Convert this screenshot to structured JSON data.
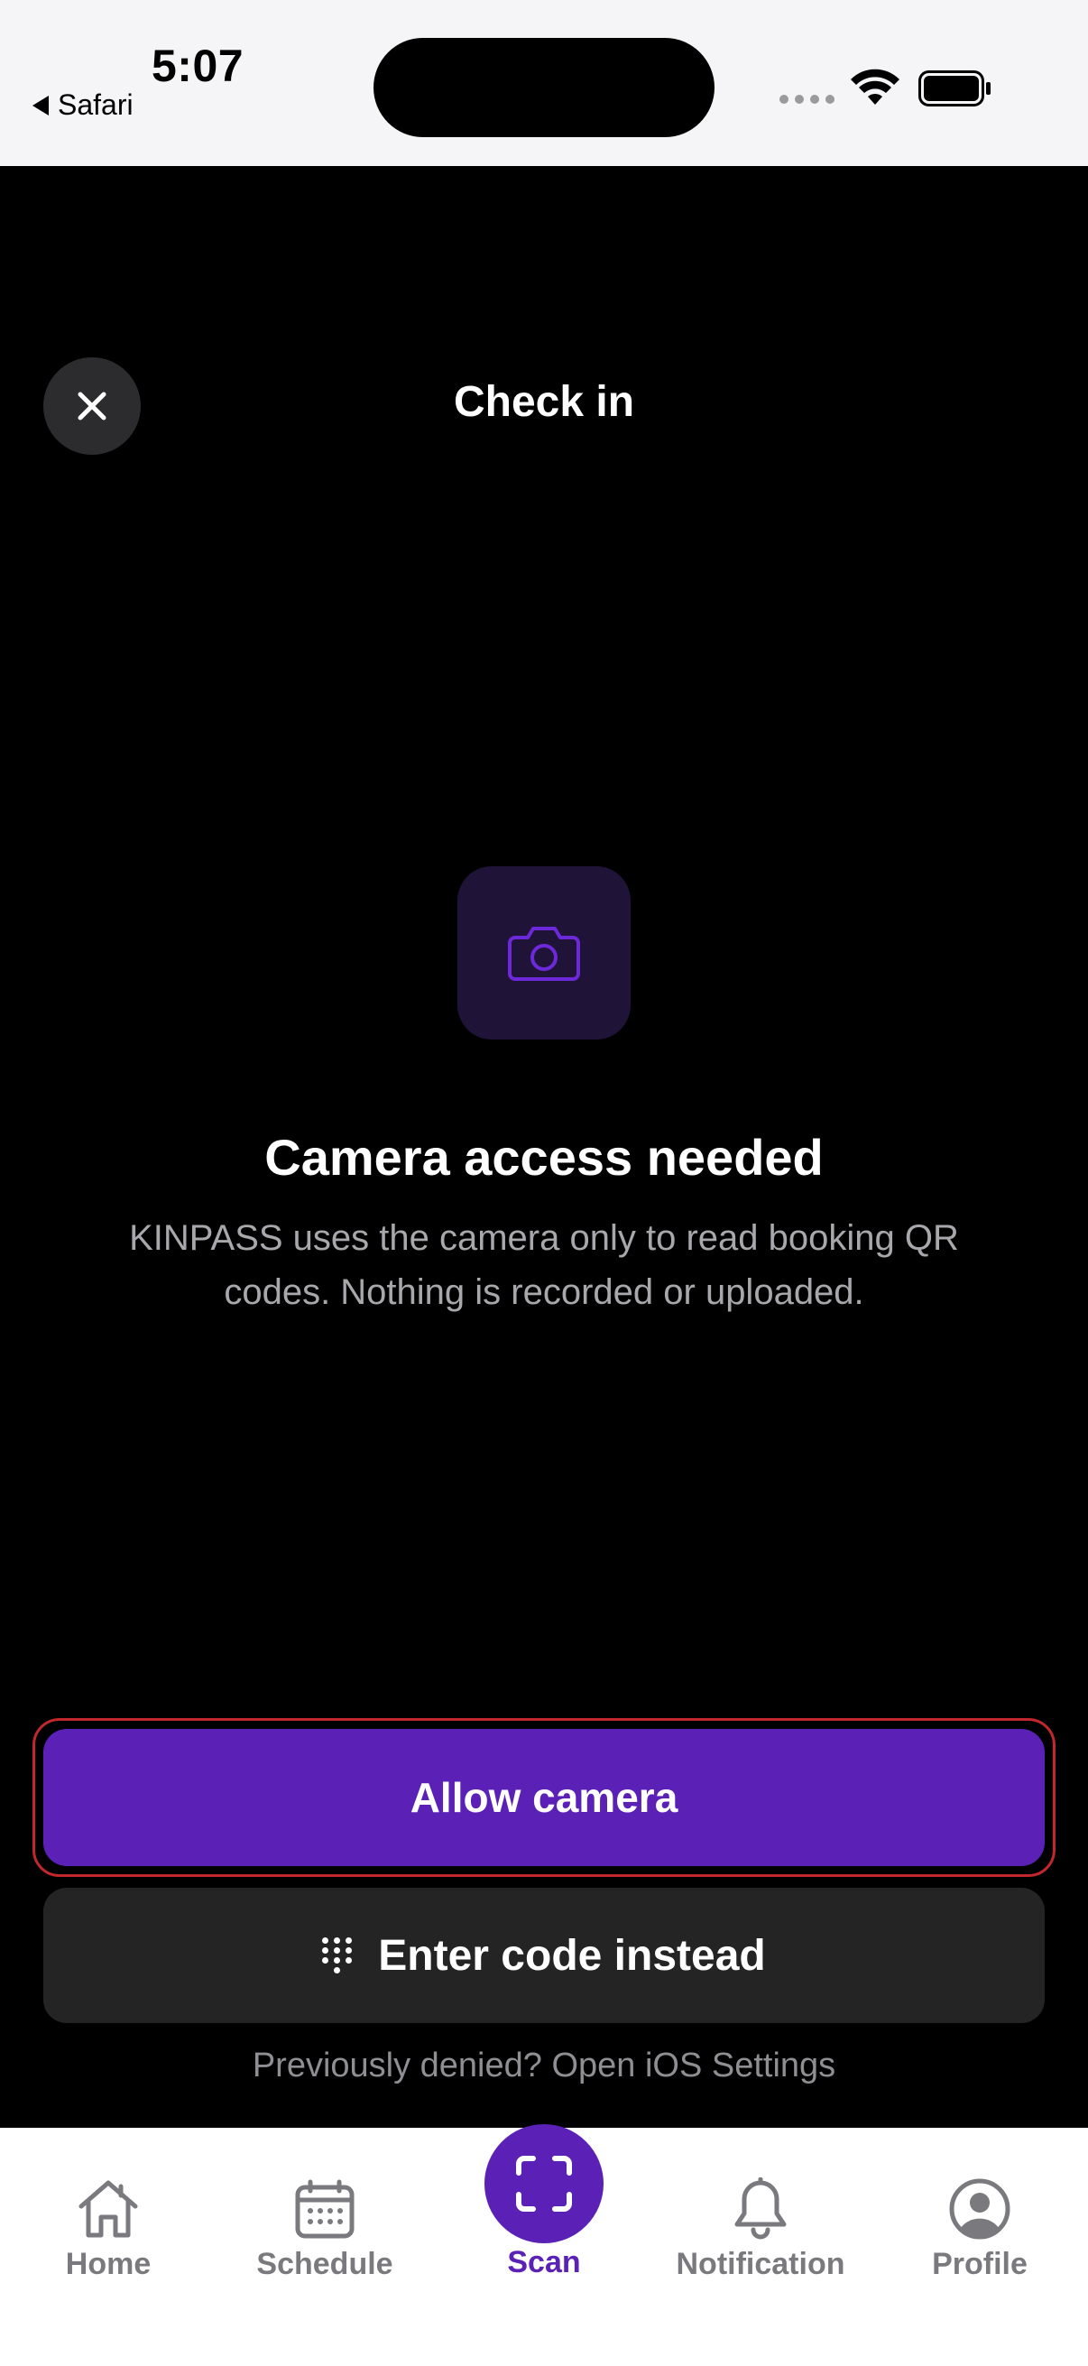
{
  "status_bar": {
    "time": "5:07",
    "back_app": "Safari",
    "icons": [
      "cellular-signal-icon",
      "wifi-icon",
      "battery-icon"
    ]
  },
  "header": {
    "title": "Check in",
    "close_icon": "close-icon"
  },
  "permission": {
    "icon": "camera-icon",
    "headline": "Camera access needed",
    "description": "KINPASS uses the camera only to read booking QR codes. Nothing is recorded or uploaded."
  },
  "actions": {
    "allow_label": "Allow camera",
    "enter_code_label": "Enter code instead",
    "enter_code_icon": "keypad-icon",
    "settings_link": "Previously denied? Open iOS Settings"
  },
  "tabbar": {
    "items": [
      {
        "label": "Home",
        "icon": "home-icon",
        "active": false
      },
      {
        "label": "Schedule",
        "icon": "calendar-icon",
        "active": false
      },
      {
        "label": "Scan",
        "icon": "scan-icon",
        "active": true
      },
      {
        "label": "Notification",
        "icon": "bell-icon",
        "active": false
      },
      {
        "label": "Profile",
        "icon": "profile-icon",
        "active": false
      }
    ]
  },
  "colors": {
    "accent": "#5b21b6",
    "background": "#000000",
    "focus_ring": "#c1272d",
    "secondary_button": "#242424",
    "muted_text": "#8e8e93"
  }
}
